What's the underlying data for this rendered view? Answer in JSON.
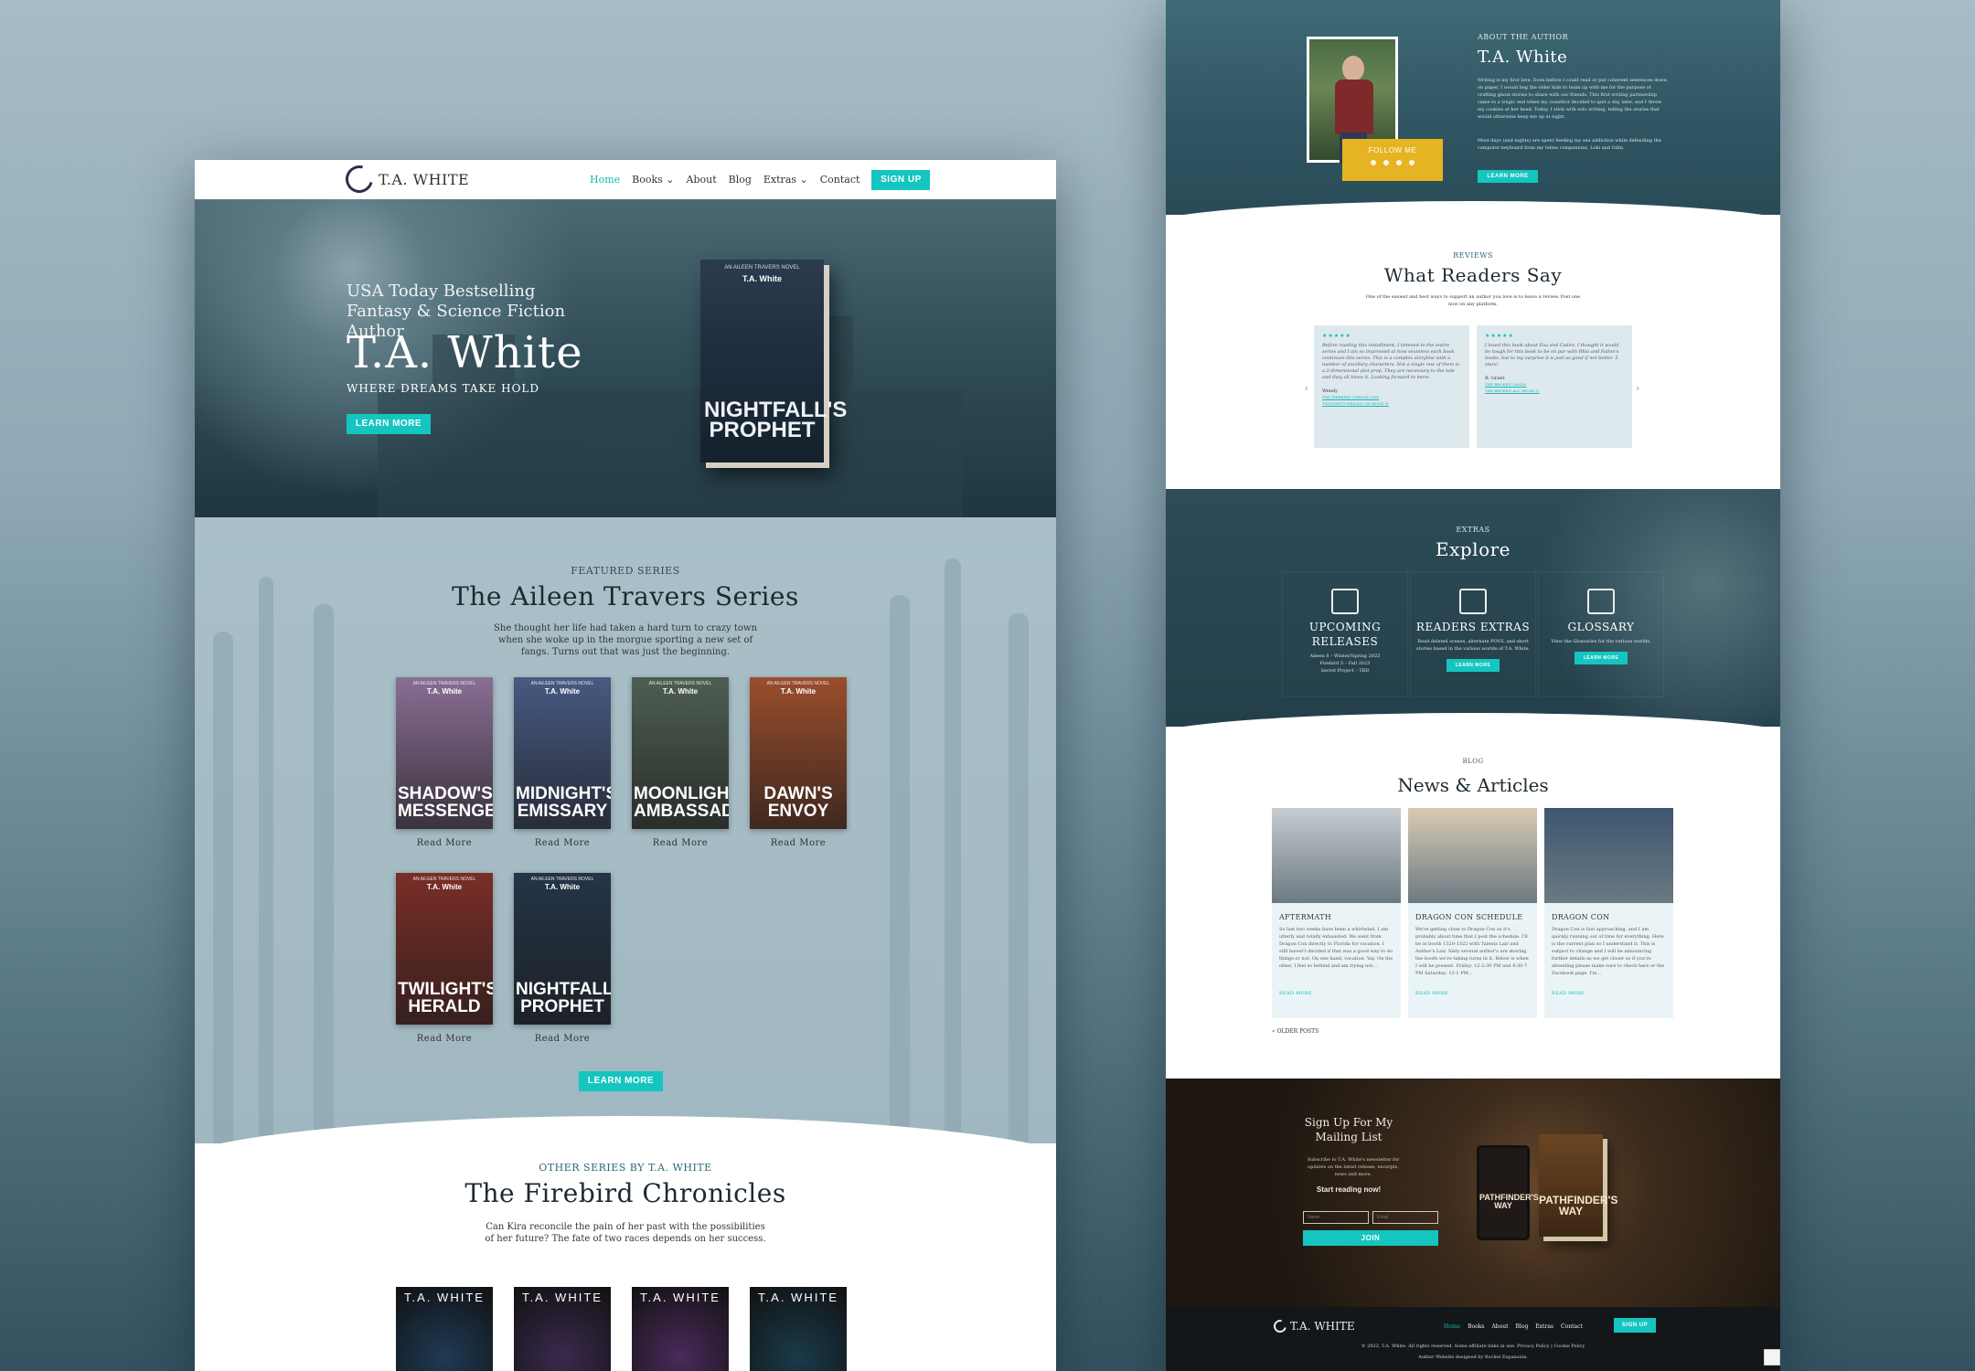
{
  "site": {
    "logo_text": "T.A. WHITE",
    "nav": [
      "Home",
      "Books",
      "About",
      "Blog",
      "Extras",
      "Contact"
    ],
    "signup": "SIGN UP"
  },
  "hero": {
    "subtitle": "USA Today Bestselling Fantasy & Science Fiction Author",
    "title": "T.A. White",
    "tagline": "WHERE DREAMS TAKE HOLD",
    "button": "LEARN MORE",
    "book": {
      "series": "AN AILEEN TRAVERS NOVEL",
      "author": "T.A. White",
      "title": "NIGHTFALL'S\nPROPHET"
    }
  },
  "featured": {
    "eyebrow": "FEATURED SERIES",
    "title": "The Aileen Travers Series",
    "desc": "She thought her life had taken a hard turn to crazy town when she woke up in the morgue sporting a new set of fangs. Turns out that was just the beginning.",
    "read_more": "Read More",
    "button": "LEARN MORE",
    "series_label": "AN AILEEN TRAVERS NOVEL",
    "author": "T.A. White",
    "books": [
      {
        "title": "SHADOW'S\nMESSENGER",
        "color": "#8a6e95"
      },
      {
        "title": "MIDNIGHT'S\nEMISSARY",
        "color": "#475a82"
      },
      {
        "title": "MOONLIGHT'S\nAMBASSADOR",
        "color": "#4e5e52"
      },
      {
        "title": "DAWN'S\nENVOY",
        "color": "#9a4d2c"
      },
      {
        "title": "TWILIGHT'S\nHERALD",
        "color": "#7a2e27"
      },
      {
        "title": "NIGHTFALL'S\nPROPHET",
        "color": "#243447"
      }
    ]
  },
  "other": {
    "eyebrow": "OTHER SERIES BY T.A. WHITE",
    "title": "The Firebird Chronicles",
    "desc": "Can Kira reconcile the pain of her past with the possibilities of her future? The fate of two races depends on her success.",
    "author": "T.A. WHITE",
    "colors": [
      "#1f3a55",
      "#3a2a4e",
      "#4a2a5a",
      "#1a3a4a"
    ]
  },
  "about": {
    "eyebrow": "ABOUT THE AUTHOR",
    "name": "T.A. White",
    "p1": "Writing is my first love. Even before I could read or put coherent sentences down on paper, I would beg the older kids to team up with me for the purpose of crafting ghost stories to share with our friends. This first writing partnership came to a tragic end when my coauthor decided to quit a day later, and I threw my cookies at her head. Today, I stick with solo writing, telling the stories that would otherwise keep me up at night.",
    "p2": "Most days (and nights) are spent feeding my sea addiction while defending the computer keyboard from my feline companions, Loki and Odin.",
    "follow": "FOLLOW ME",
    "button": "LEARN MORE"
  },
  "reviews": {
    "eyebrow": "REVIEWS",
    "title": "What Readers Say",
    "desc": "One of the easiest and best ways to support an author you love is to leave a review. Post one now on any platform.",
    "items": [
      {
        "stars": "★★★★★",
        "text": "Before reading this installment, I listened to the entire series and I am so impressed at how seamless each book continues this series. This is a complex storyline with a number of ancillary characters. Not a single one of them is a 2-dimensional plot prop. They are necessary to the tale and they all know it. Looking forward to more.",
        "name": "Wendy",
        "link1": "THE FIREBIRD CHRONICLES",
        "link2": "TWILIGHT'S HERALD (AT BOOK 5)"
      },
      {
        "stars": "★★★★★",
        "text": "I loved this book about Eva and Caden. I thought it would be tough for this book to be on par with Rhia and Fallon's books, but to my surprise it is just as good if not better. 5 stars!",
        "name": "B. Grant",
        "link1": "THE BROKEN LANDS",
        "link2": "THE BROKEN ALL (BOOK 3)"
      }
    ]
  },
  "extras": {
    "eyebrow": "EXTRAS",
    "title": "Explore",
    "cols": [
      {
        "title": "UPCOMING RELEASES",
        "text": "Aileen 8 – Winter/Spring 2023\nFirebird 5 – Fall 2023\nSecret Project – TBD",
        "button": ""
      },
      {
        "title": "READERS EXTRAS",
        "text": "Read deleted scenes, alternate POVS, and short stories based in the various worlds of T.A. White.",
        "button": "LEARN MORE"
      },
      {
        "title": "GLOSSARY",
        "text": "View the Glossaries for the various worlds.",
        "button": "LEARN MORE"
      }
    ]
  },
  "blog": {
    "eyebrow": "BLOG",
    "title": "News & Articles",
    "read_more": "READ MORE",
    "older": "« OLDER POSTS",
    "posts": [
      {
        "title": "AFTERMATH",
        "text": "So last two weeks have been a whirlwind. I am utterly and totally exhausted. We went from Dragon Con directly to Florida for vacation. I still haven't decided if that was a good way to do things or not. On one hand, vacation. Yay. On the other, I feel so behind and am trying not...",
        "img": "#c7ccd0"
      },
      {
        "title": "DRAGON CON SCHEDULE",
        "text": "We're getting close to Dragon Con so it's probably about time that I post the schedule. I'll be in booth 1320-1322 with Talents Lair and Author's Lair. Sixty several author's are sharing the booth we're taking turns in it. Below is when I will be present. Friday: 12-2:30 PM and 4:30-7 PM Saturday: 12-1 PM...",
        "img": "#d9cbb3"
      },
      {
        "title": "DRAGON CON",
        "text": "Dragon Con is fast approaching, and I am quickly running out of time for everything. Here is the current plan so I understand it. This is subject to change and I will be announcing further details as we get closer so if you're attending please make sure to check here or the Facebook page. I'm...",
        "img": "#3d5670"
      }
    ]
  },
  "mailing": {
    "title": "Sign Up For My\nMailing List",
    "desc": "Subscribe to T.A. White's newsletter for updates on the latest release, excerpts, news and more.",
    "cta": "Start reading now!",
    "name_ph": "Name",
    "email_ph": "Email",
    "button": "JOIN",
    "book_title": "PATHFINDER'S\nWAY",
    "tablet_title": "PATHFINDER'S\nWAY"
  },
  "footer": {
    "nav": [
      "Home",
      "Books",
      "About",
      "Blog",
      "Extras",
      "Contact"
    ],
    "signup": "SIGN UP",
    "copyright": "© 2022, T.A. White. All rights reserved. Some affiliate links in use. Privacy Policy | Cookie Policy",
    "credit": "Author Website designed by Rocket Expansion."
  },
  "colors": {
    "accent": "#15c5c0",
    "gold": "#e6b422"
  }
}
